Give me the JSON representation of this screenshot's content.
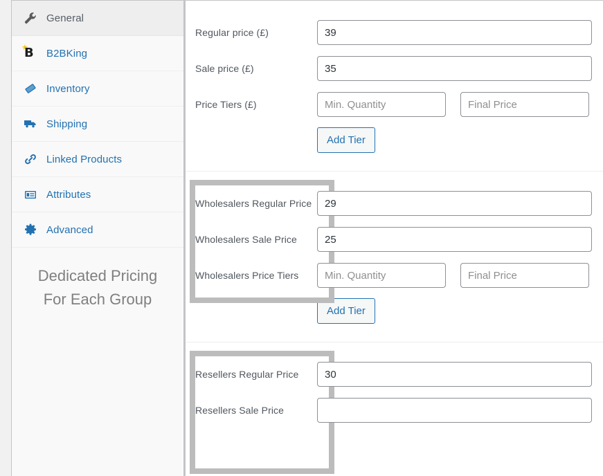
{
  "sidebar": {
    "tabs": [
      {
        "label": "General",
        "icon": "wrench-icon",
        "active": true
      },
      {
        "label": "B2BKing",
        "icon": "b2bking-logo-icon",
        "active": false
      },
      {
        "label": "Inventory",
        "icon": "tag-icon",
        "active": false
      },
      {
        "label": "Shipping",
        "icon": "truck-icon",
        "active": false
      },
      {
        "label": "Linked Products",
        "icon": "link-icon",
        "active": false
      },
      {
        "label": "Attributes",
        "icon": "list-card-icon",
        "active": false
      },
      {
        "label": "Advanced",
        "icon": "gear-icon",
        "active": false
      }
    ],
    "caption_line1": "Dedicated Pricing",
    "caption_line2": "For Each Group"
  },
  "content": {
    "groups": [
      {
        "id": "default-pricing",
        "highlighted": false,
        "fields": [
          {
            "label": "Regular price (£)",
            "type": "single",
            "value": "39",
            "placeholder": ""
          },
          {
            "label": "Sale price (£)",
            "type": "single",
            "value": "35",
            "placeholder": ""
          },
          {
            "label": "Price Tiers (£)",
            "type": "tier",
            "min_qty_value": "",
            "min_qty_placeholder": "Min. Quantity",
            "final_price_value": "",
            "final_price_placeholder": "Final Price"
          }
        ],
        "add_tier_label": "Add Tier"
      },
      {
        "id": "wholesalers-pricing",
        "highlighted": true,
        "fields": [
          {
            "label": "Wholesalers Regular Price",
            "type": "single",
            "value": "29",
            "placeholder": ""
          },
          {
            "label": "Wholesalers Sale Price",
            "type": "single",
            "value": "25",
            "placeholder": ""
          },
          {
            "label": "Wholesalers Price Tiers",
            "type": "tier",
            "min_qty_value": "",
            "min_qty_placeholder": "Min. Quantity",
            "final_price_value": "",
            "final_price_placeholder": "Final Price"
          }
        ],
        "add_tier_label": "Add Tier"
      },
      {
        "id": "resellers-pricing",
        "highlighted": true,
        "fields": [
          {
            "label": "Resellers Regular Price",
            "type": "single",
            "value": "30",
            "placeholder": ""
          },
          {
            "label": "Resellers Sale Price",
            "type": "single",
            "value": "",
            "placeholder": ""
          }
        ],
        "add_tier_label": ""
      }
    ]
  },
  "colors": {
    "link_blue": "#2271b1",
    "label_gray": "#50575e",
    "highlight_border": "#bcbcbc",
    "sidebar_bg": "#f9f9f9",
    "active_tab_bg": "#eeeeee",
    "logo_black": "#1d1d1d",
    "logo_star_yellow": "#f5c518"
  }
}
